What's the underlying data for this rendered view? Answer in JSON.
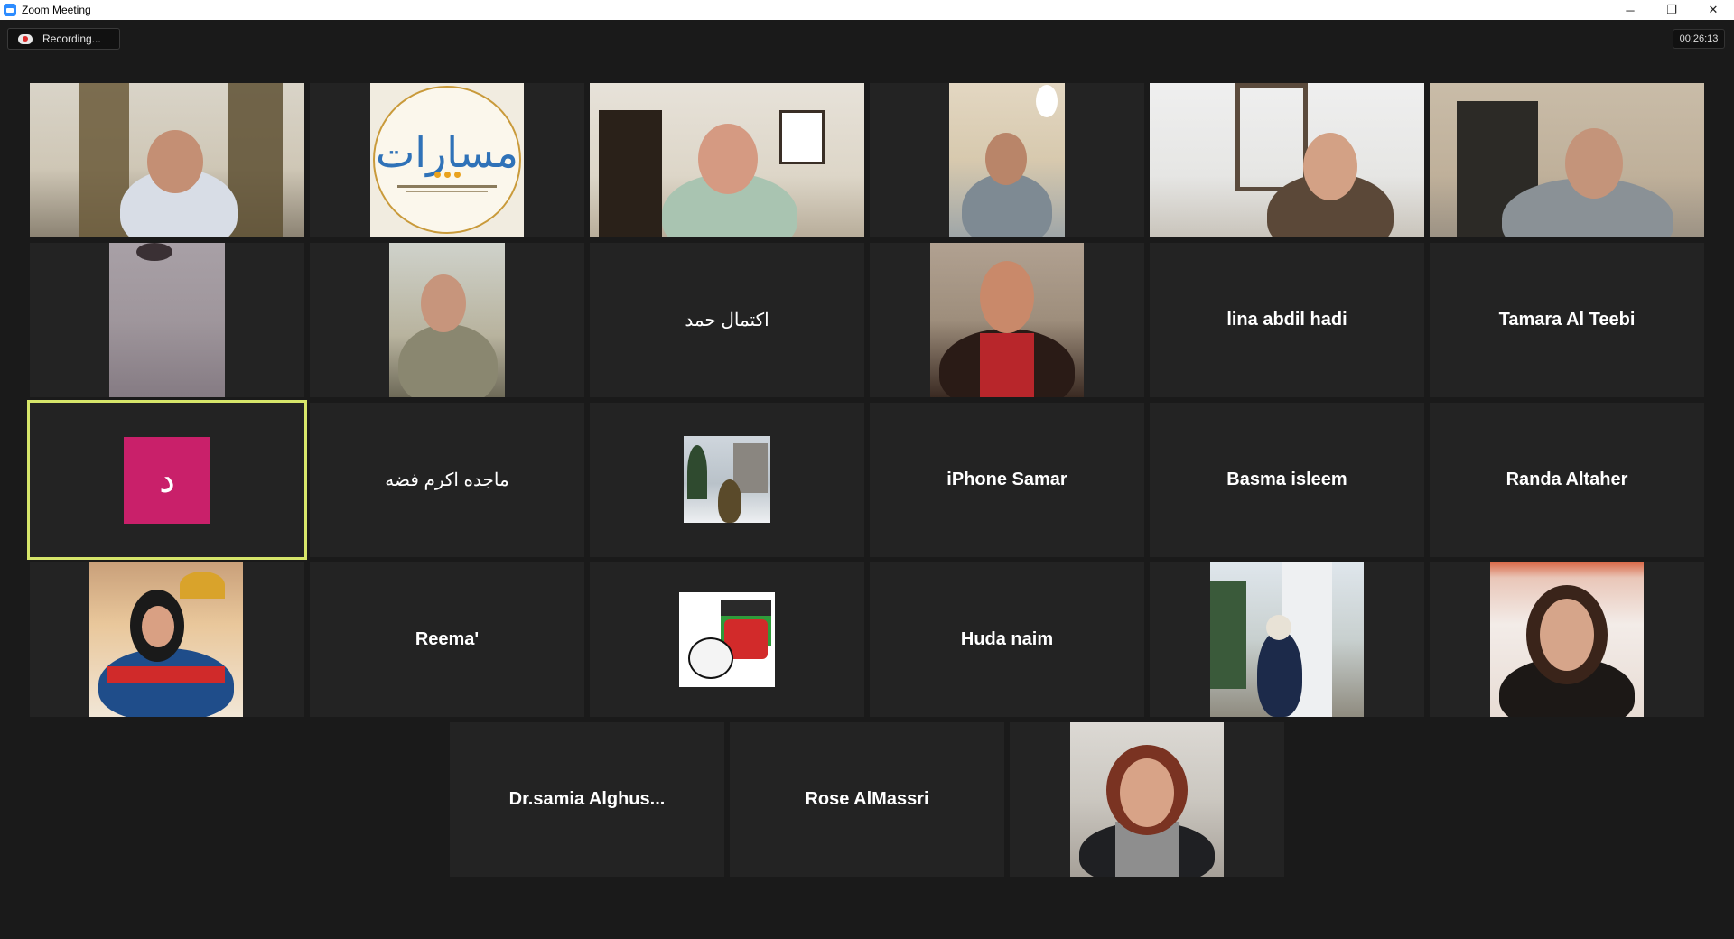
{
  "window": {
    "title": "Zoom Meeting"
  },
  "window_controls": {
    "minimize": "─",
    "restore": "❐",
    "close": "✕"
  },
  "recording": {
    "label": "Recording..."
  },
  "timer": {
    "elapsed": "00:26:13"
  },
  "participants": {
    "r2c3": "اكتمال حمد",
    "r2c5": "lina abdil hadi",
    "r2c6": "Tamara Al Teebi",
    "r3c1_initial": "د",
    "r3c2": "ماجده اكرم فضه",
    "r3c4": "iPhone Samar",
    "r3c5": "Basma isleem",
    "r3c6": "Randa Altaher",
    "r4c2": "Reema'",
    "r4c4": "Huda naim",
    "r5c1": "Dr.samia  Alghus...",
    "r5c2": "Rose AlMassri"
  },
  "colors": {
    "active_speaker_border": "#d6e56a",
    "avatar_bg": "#c9206a",
    "tile_bg": "#232323"
  }
}
